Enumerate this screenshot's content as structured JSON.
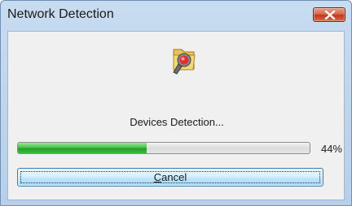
{
  "window": {
    "title": "Network Detection"
  },
  "titlebar": {
    "close_icon": "close-icon"
  },
  "content": {
    "app_icon": "search-device-icon",
    "status_text": "Devices Detection...",
    "progress": {
      "value_percent": 44,
      "label": "44%"
    },
    "cancel_button": {
      "accelerator": "C",
      "rest": "ancel"
    }
  },
  "colors": {
    "progress_fill": "#21a321",
    "close_button": "#c0391f",
    "button_border": "#3c7fb1"
  }
}
